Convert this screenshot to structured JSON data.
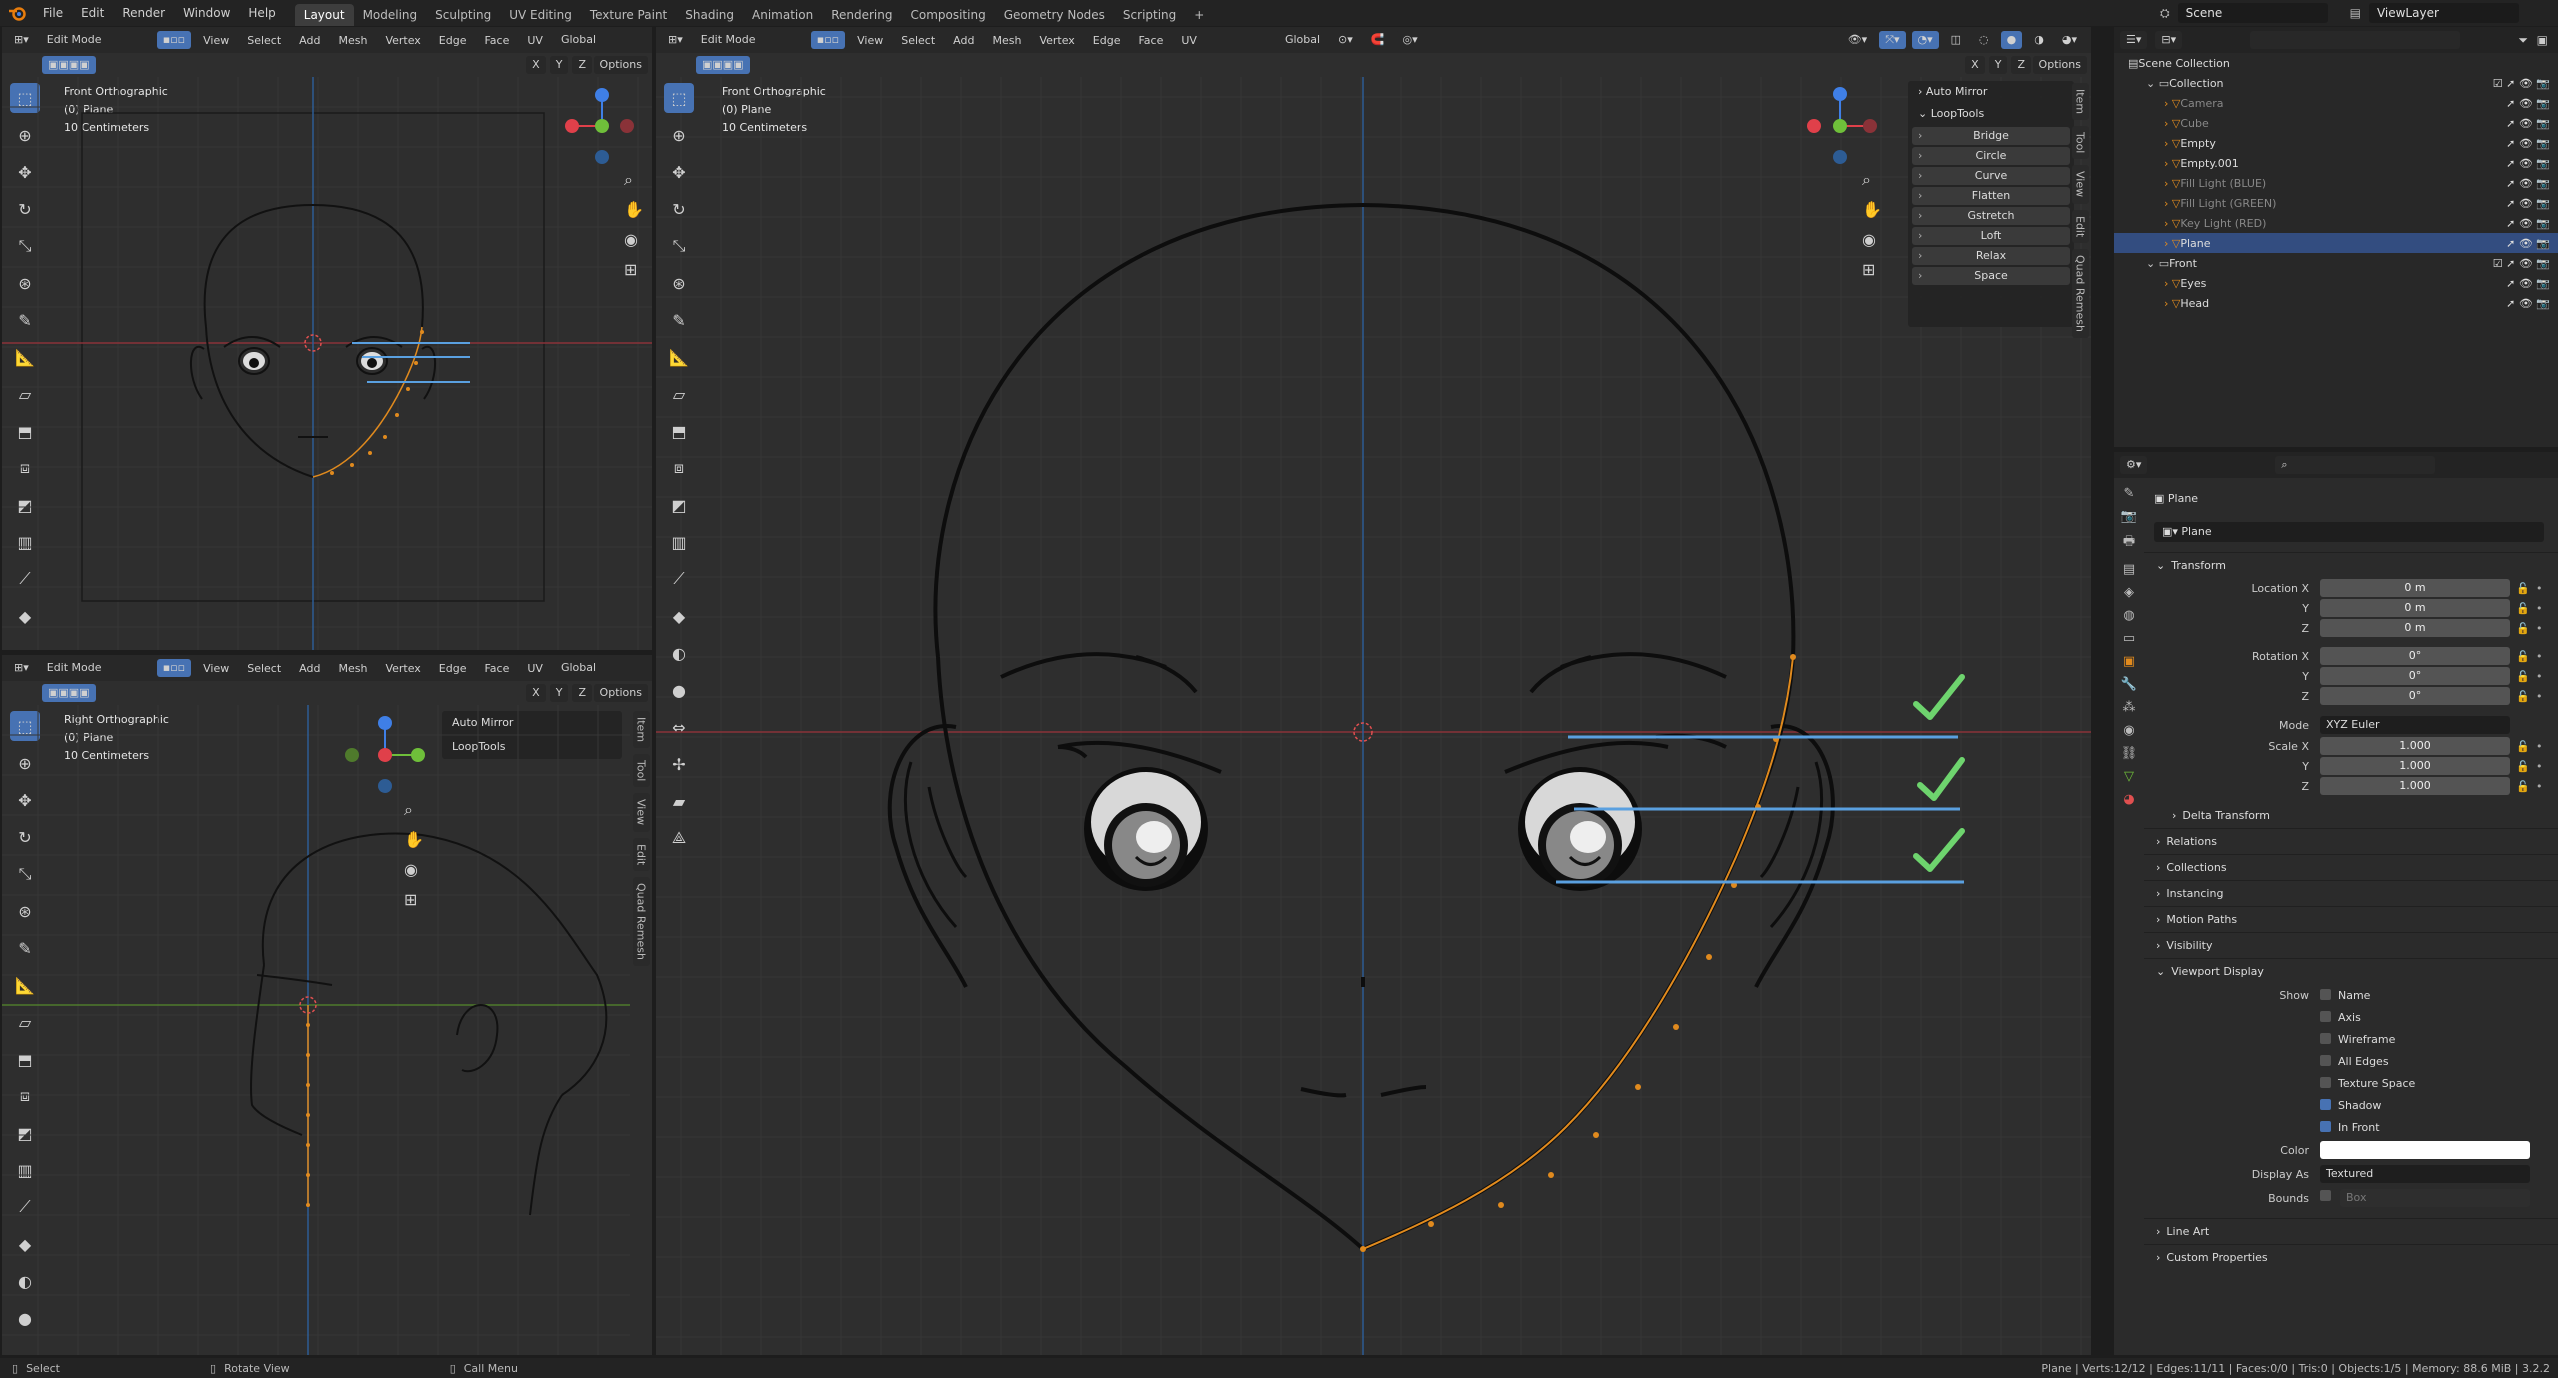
{
  "menubar": {
    "items": [
      "File",
      "Edit",
      "Render",
      "Window",
      "Help"
    ],
    "workspaces": [
      "Layout",
      "Modeling",
      "Sculpting",
      "UV Editing",
      "Texture Paint",
      "Shading",
      "Animation",
      "Rendering",
      "Compositing",
      "Geometry Nodes",
      "Scripting"
    ],
    "active_workspace": "Layout",
    "add_tab": "+",
    "scene": "Scene",
    "view_layer": "ViewLayer"
  },
  "viewport_header": {
    "mode": "Edit Mode",
    "menus": [
      "View",
      "Select",
      "Add",
      "Mesh",
      "Vertex",
      "Edge",
      "Face",
      "UV"
    ],
    "orientation": "Global",
    "options": "Options",
    "xyz": [
      "X",
      "Y",
      "Z"
    ]
  },
  "vp_top_left": {
    "view_name": "Front Orthographic",
    "object": "(0) Plane",
    "scale": "10 Centimeters"
  },
  "vp_bottom_left": {
    "view_name": "Right Orthographic",
    "object": "(0) Plane",
    "scale": "10 Centimeters",
    "auto_mirror": "Auto Mirror",
    "looptools": "LoopTools"
  },
  "vp_main": {
    "view_name": "Front Orthographic",
    "object": "(0) Plane",
    "scale": "10 Centimeters"
  },
  "side_tabs": [
    "Item",
    "Tool",
    "View",
    "Edit",
    "Quad Remesh"
  ],
  "looptools": {
    "auto_mirror": "Auto Mirror",
    "title": "LoopTools",
    "buttons": [
      "Bridge",
      "Circle",
      "Curve",
      "Flatten",
      "Gstretch",
      "Loft",
      "Relax",
      "Space"
    ]
  },
  "outliner": {
    "search_placeholder": "",
    "rows": [
      {
        "name": "Scene Collection",
        "depth": 0,
        "state": "normal"
      },
      {
        "name": "Collection",
        "depth": 1,
        "state": "normal"
      },
      {
        "name": "Camera",
        "depth": 2,
        "state": "dim"
      },
      {
        "name": "Cube",
        "depth": 2,
        "state": "dim"
      },
      {
        "name": "Empty",
        "depth": 2,
        "state": "normal"
      },
      {
        "name": "Empty.001",
        "depth": 2,
        "state": "normal"
      },
      {
        "name": "Fill Light (BLUE)",
        "depth": 2,
        "state": "dim"
      },
      {
        "name": "Fill Light (GREEN)",
        "depth": 2,
        "state": "dim"
      },
      {
        "name": "Key Light (RED)",
        "depth": 2,
        "state": "dim"
      },
      {
        "name": "Plane",
        "depth": 2,
        "state": "selected"
      },
      {
        "name": "Front",
        "depth": 1,
        "state": "normal"
      },
      {
        "name": "Eyes",
        "depth": 2,
        "state": "normal"
      },
      {
        "name": "Head",
        "depth": 2,
        "state": "normal"
      }
    ]
  },
  "properties": {
    "object_name": "Plane",
    "object_field": "Plane",
    "transform": "Transform",
    "location_label": "Location X",
    "location": [
      "0 m",
      "0 m",
      "0 m"
    ],
    "rotation_label": "Rotation X",
    "rotation": [
      "0°",
      "0°",
      "0°"
    ],
    "mode_label": "Mode",
    "mode": "XYZ Euler",
    "scale_label": "Scale X",
    "scale": [
      "1.000",
      "1.000",
      "1.000"
    ],
    "axis_y": "Y",
    "axis_z": "Z",
    "delta": "Delta Transform",
    "sections_collapsed": [
      "Relations",
      "Collections",
      "Instancing",
      "Motion Paths",
      "Visibility"
    ],
    "viewport_display": "Viewport Display",
    "show_label": "Show",
    "show_options": [
      {
        "label": "Name",
        "checked": false
      },
      {
        "label": "Axis",
        "checked": false
      },
      {
        "label": "Wireframe",
        "checked": false
      },
      {
        "label": "All Edges",
        "checked": false
      },
      {
        "label": "Texture Space",
        "checked": false
      },
      {
        "label": "Shadow",
        "checked": true
      },
      {
        "label": "In Front",
        "checked": true
      }
    ],
    "color_label": "Color",
    "display_as_label": "Display As",
    "display_as": "Textured",
    "bounds_label": "Bounds",
    "bounds_value": "Box",
    "line_art": "Line Art",
    "custom_props": "Custom Properties"
  },
  "statusbar": {
    "select": "Select",
    "rotate": "Rotate View",
    "menu": "Call Menu",
    "stats": "Plane | Verts:12/12 | Edges:11/11 | Faces:0/0 | Tris:0 | Objects:1/5 | Memory: 88.6 MiB | 3.2.2"
  },
  "colors": {
    "accent": "#4772b3",
    "edit_orange": "#e08a1e",
    "guide_blue": "#5aa0e0",
    "check_green": "#6ed46e",
    "x_axis": "#e0404a",
    "y_axis": "#6fbf3a",
    "z_axis": "#3f7fe6"
  }
}
